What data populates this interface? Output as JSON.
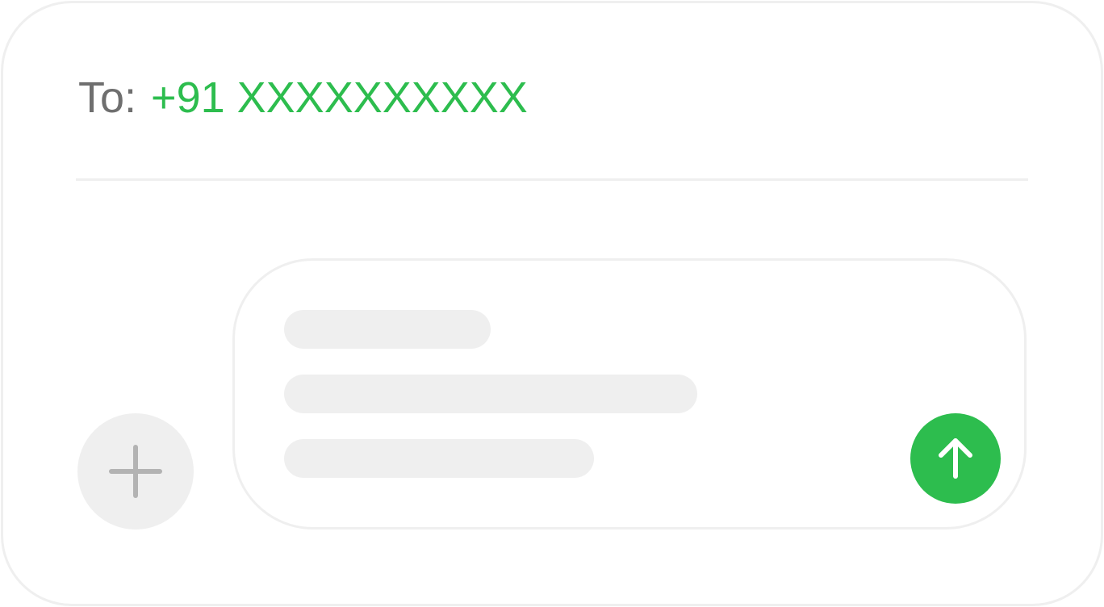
{
  "header": {
    "to_label": "To:",
    "recipient": "+91 XXXXXXXXXX"
  },
  "composer": {
    "placeholder_lines": 3,
    "send_icon": "arrow-up-icon",
    "add_icon": "plus-icon"
  },
  "colors": {
    "accent": "#2dbd4e",
    "placeholder": "#efefef",
    "label": "#6f6f6f"
  }
}
